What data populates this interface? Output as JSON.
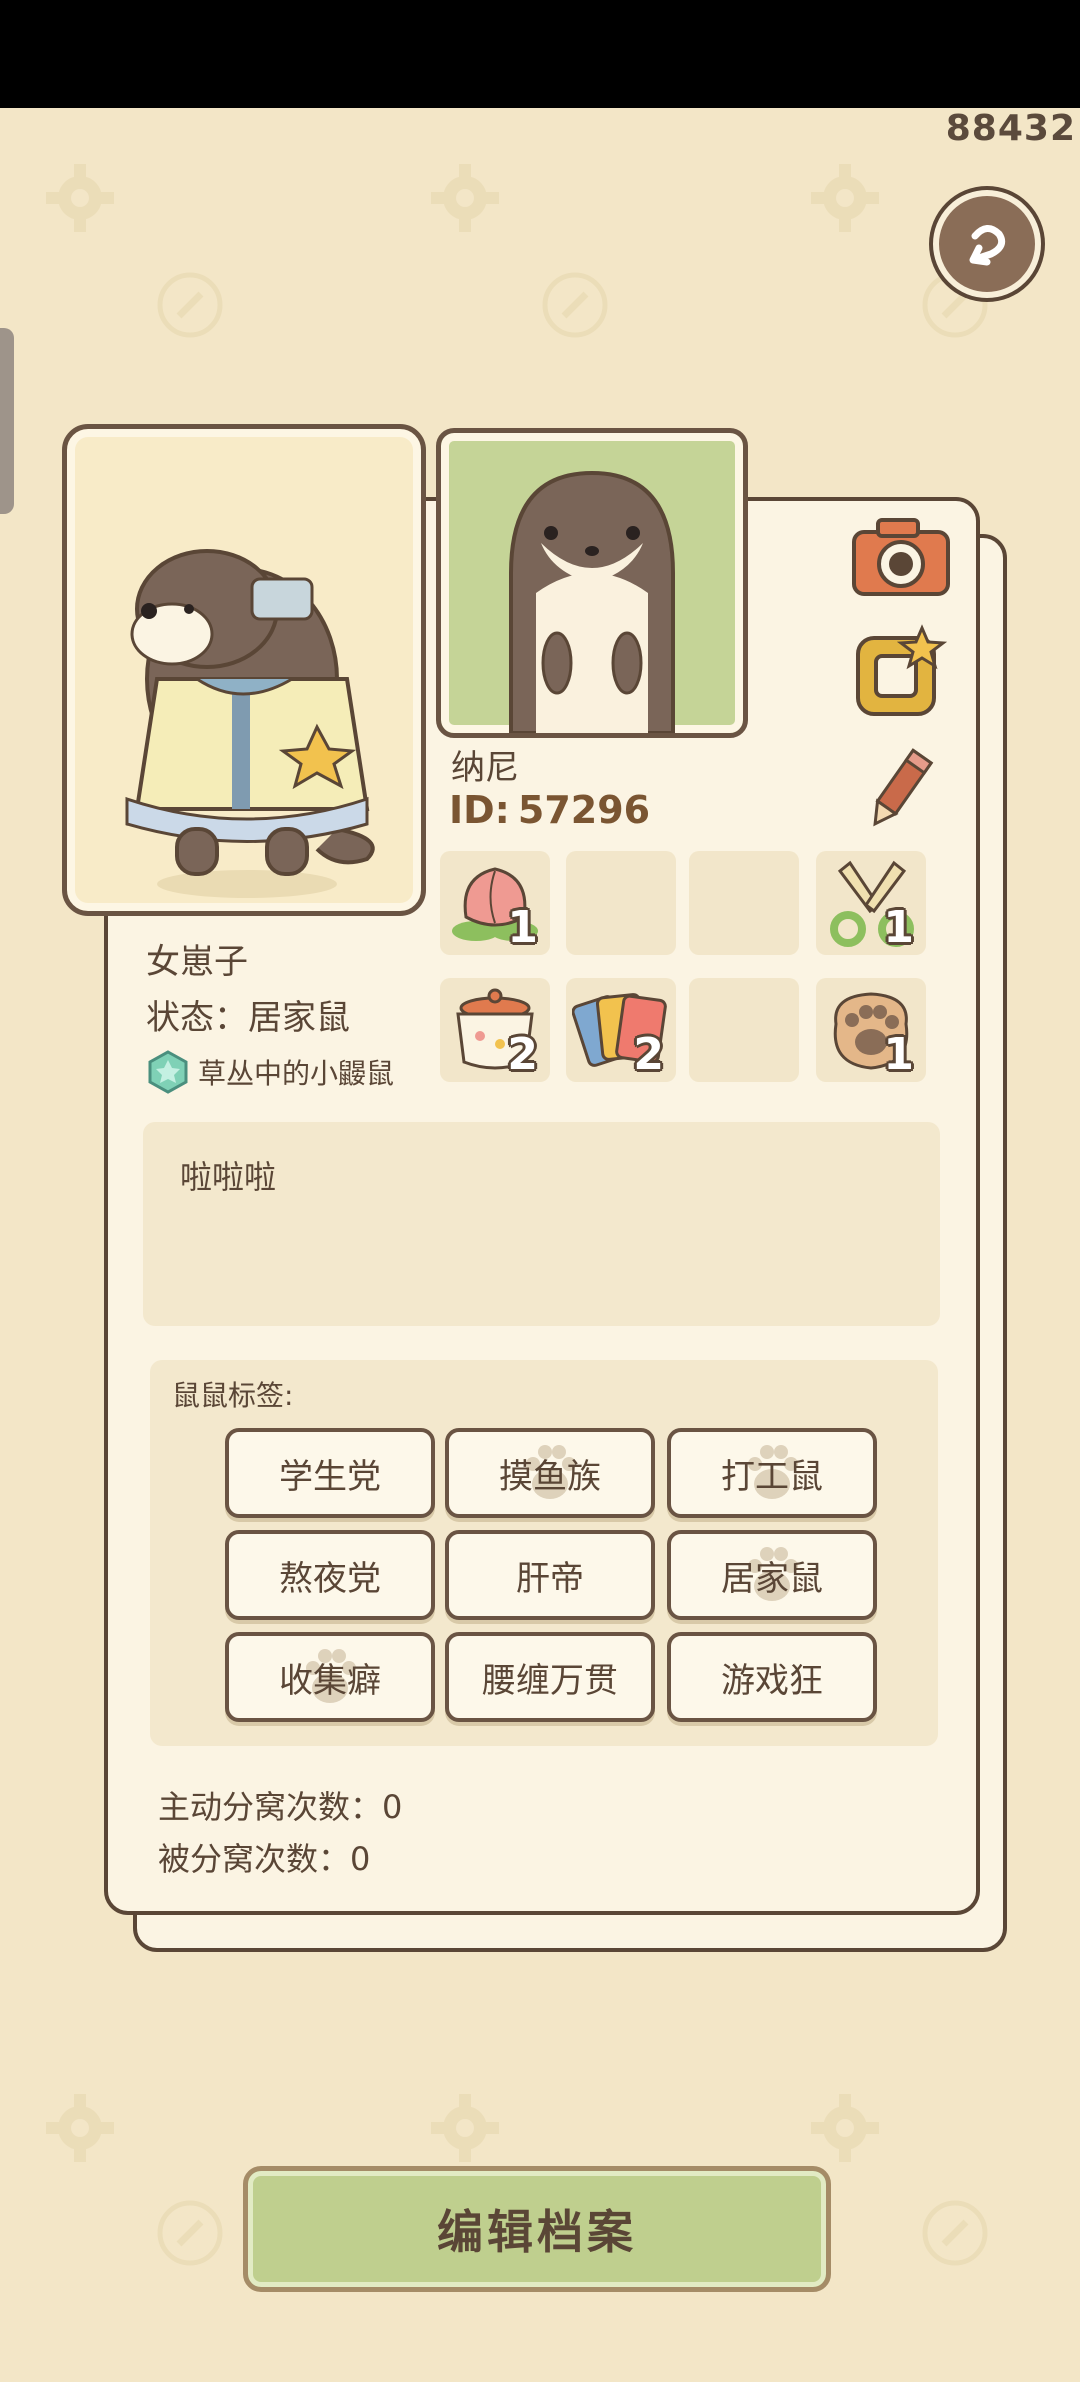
{
  "header": {
    "counter": "88432"
  },
  "profile": {
    "nickname": "纳尼",
    "id_label": "ID:",
    "id_value": "57296",
    "name": "女崽子",
    "status": "状态：居家鼠",
    "title": "草丛中的小鼹鼠"
  },
  "items": [
    {
      "icon": "peach-flower-icon",
      "count": "1"
    },
    {
      "icon": "",
      "count": ""
    },
    {
      "icon": "",
      "count": ""
    },
    {
      "icon": "scissors-icon",
      "count": "1"
    },
    {
      "icon": "pot-icon",
      "count": "2"
    },
    {
      "icon": "cards-icon",
      "count": "2"
    },
    {
      "icon": "",
      "count": ""
    },
    {
      "icon": "paw-cookie-icon",
      "count": "1"
    }
  ],
  "bio": "啦啦啦",
  "tags": {
    "title": "鼠鼠标签:",
    "list": [
      "学生党",
      "摸鱼族",
      "打工鼠",
      "熬夜党",
      "肝帝",
      "居家鼠",
      "收集癖",
      "腰缠万贯",
      "游戏狂"
    ]
  },
  "stats": {
    "active_split": "主动分窝次数：0",
    "passive_split": "被分窝次数：0"
  },
  "buttons": {
    "edit": "编辑档案"
  },
  "colors": {
    "accent_green": "#bfcf8e",
    "border_brown": "#5a4636",
    "card_bg": "#fbf4e3",
    "page_bg": "#f3e6c7"
  }
}
